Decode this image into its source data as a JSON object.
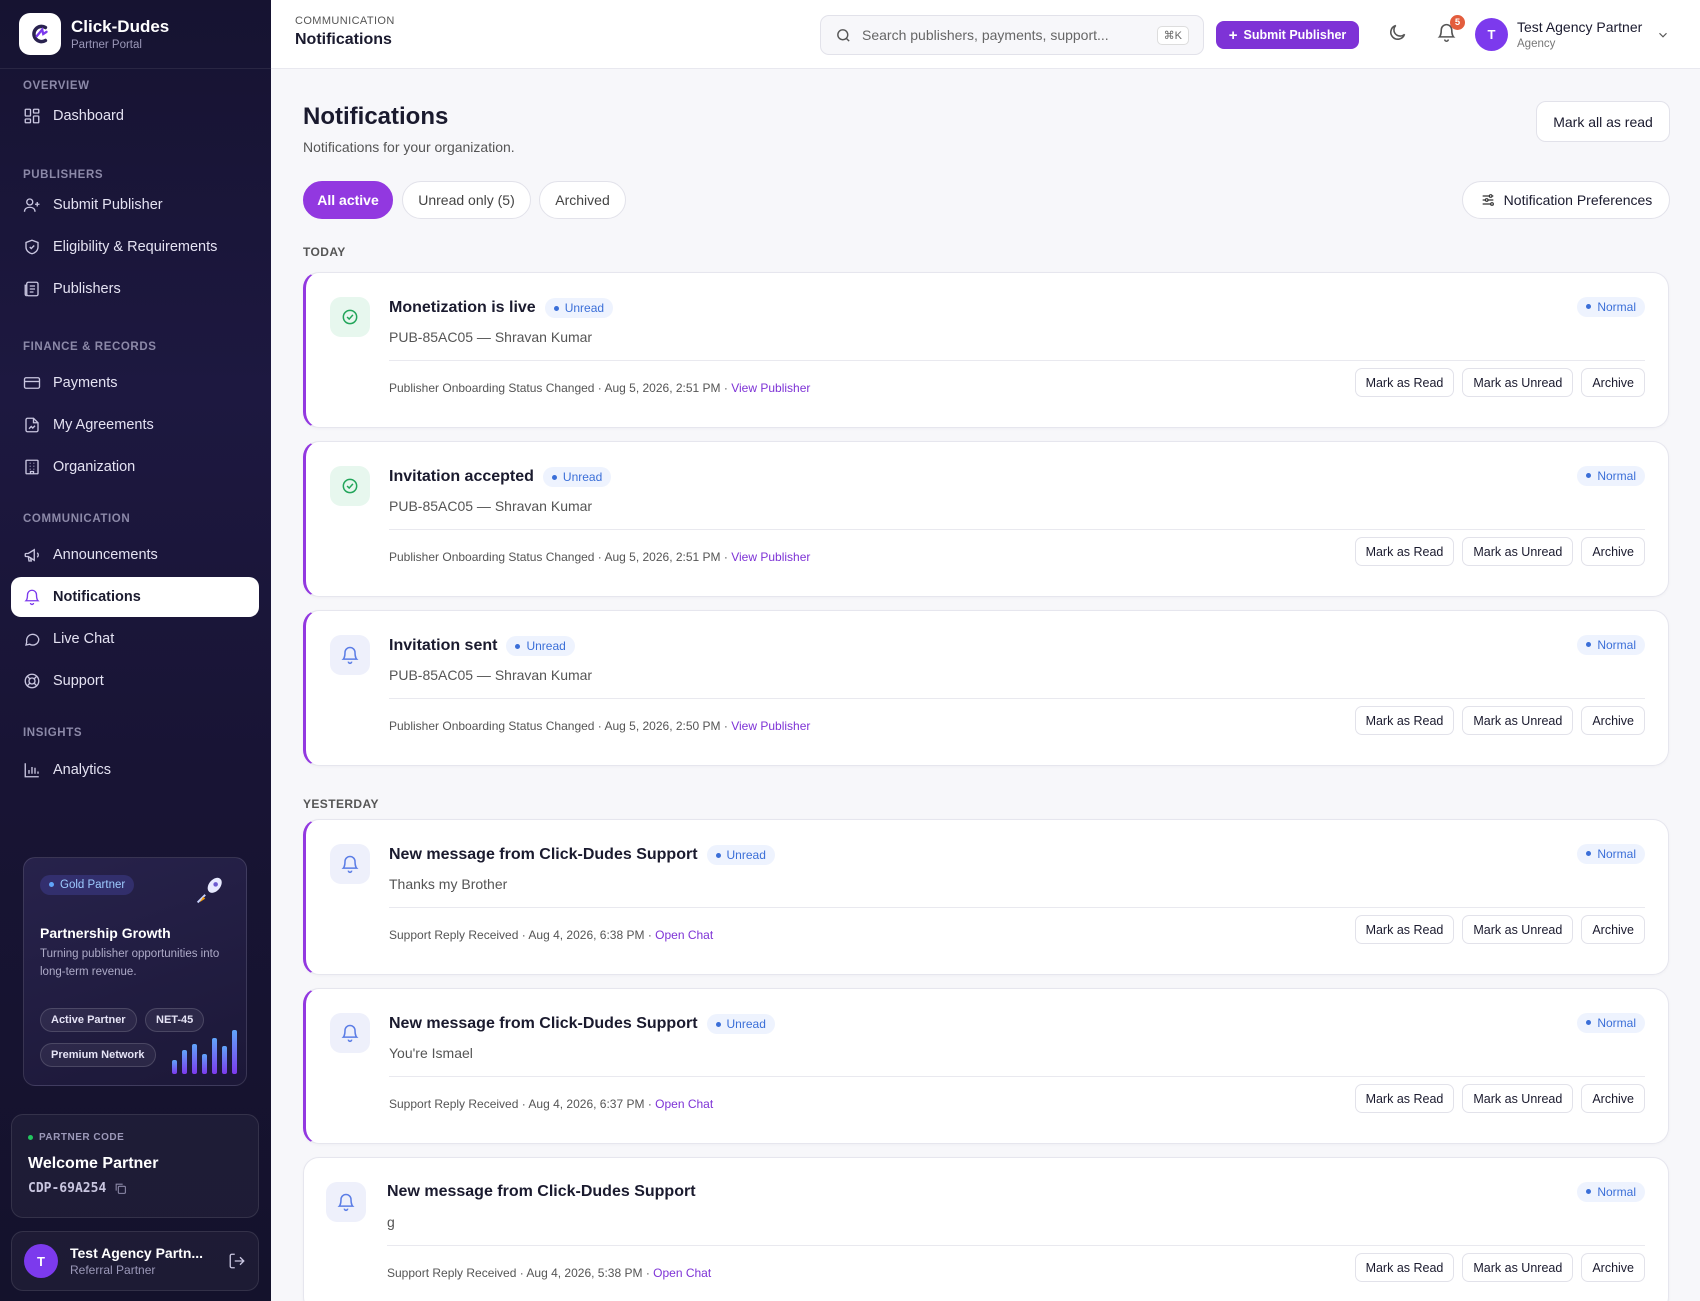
{
  "brand": {
    "name": "Click-Dudes",
    "sub": "Partner Portal"
  },
  "sidebar": {
    "sections": {
      "overview": "OVERVIEW",
      "publishers": "PUBLISHERS",
      "finance": "FINANCE & RECORDS",
      "communication": "COMMUNICATION",
      "insights": "INSIGHTS"
    },
    "items": {
      "dashboard": "Dashboard",
      "submit_publisher": "Submit Publisher",
      "eligibility": "Eligibility & Requirements",
      "publishers": "Publishers",
      "payments": "Payments",
      "agreements": "My Agreements",
      "organization": "Organization",
      "announcements": "Announcements",
      "notifications": "Notifications",
      "live_chat": "Live Chat",
      "support": "Support",
      "analytics": "Analytics"
    },
    "active": "notifications"
  },
  "promo": {
    "badge": "Gold Partner",
    "title": "Partnership Growth",
    "text": "Turning publisher opportunities into long-term revenue.",
    "chips": [
      "Active Partner",
      "NET-45",
      "Premium Network"
    ]
  },
  "partner_code": {
    "label": "PARTNER CODE",
    "title": "Welcome Partner",
    "code": "CDP-69A254"
  },
  "sidebar_user": {
    "name": "Test Agency Partn...",
    "role": "Referral Partner",
    "initial": "T"
  },
  "header": {
    "crumb": "COMMUNICATION",
    "title": "Notifications",
    "search_placeholder": "Search publishers, payments, support...",
    "search_kbd": "⌘K",
    "submit_label": "Submit Publisher",
    "notif_count": "5",
    "user_name": "Test Agency Partner",
    "user_role": "Agency",
    "user_initial": "T"
  },
  "page": {
    "title": "Notifications",
    "subtitle": "Notifications for your organization.",
    "mark_all": "Mark all as read",
    "preferences": "Notification Preferences",
    "tabs": [
      "All active",
      "Unread only (5)",
      "Archived"
    ]
  },
  "groups": {
    "today": "TODAY",
    "yesterday": "YESTERDAY"
  },
  "actions": {
    "read": "Mark as Read",
    "unread": "Mark as Unread",
    "archive": "Archive"
  },
  "notifications": [
    {
      "title": "Monetization is live",
      "status": "Unread",
      "body": "PUB-85AC05 — Shravan Kumar",
      "priority": "Normal",
      "meta": "Publisher Onboarding Status Changed · Aug 5, 2026, 2:51 PM · ",
      "link": "View Publisher"
    },
    {
      "title": "Invitation accepted",
      "status": "Unread",
      "body": "PUB-85AC05 — Shravan Kumar",
      "priority": "Normal",
      "meta": "Publisher Onboarding Status Changed · Aug 5, 2026, 2:51 PM · ",
      "link": "View Publisher"
    },
    {
      "title": "Invitation sent",
      "status": "Unread",
      "body": "PUB-85AC05 — Shravan Kumar",
      "priority": "Normal",
      "meta": "Publisher Onboarding Status Changed · Aug 5, 2026, 2:50 PM · ",
      "link": "View Publisher"
    },
    {
      "title": "New message from Click-Dudes Support",
      "status": "Unread",
      "body": "Thanks my Brother",
      "priority": "Normal",
      "meta": "Support Reply Received · Aug 4, 2026, 6:38 PM · ",
      "link": "Open Chat"
    },
    {
      "title": "New message from Click-Dudes Support",
      "status": "Unread",
      "body": "You're Ismael",
      "priority": "Normal",
      "meta": "Support Reply Received · Aug 4, 2026, 6:37 PM · ",
      "link": "Open Chat"
    },
    {
      "title": "New message from Click-Dudes Support",
      "status": "",
      "body": "g",
      "priority": "Normal",
      "meta": "Support Reply Received · Aug 4, 2026, 5:38 PM · ",
      "link": "Open Chat"
    }
  ]
}
